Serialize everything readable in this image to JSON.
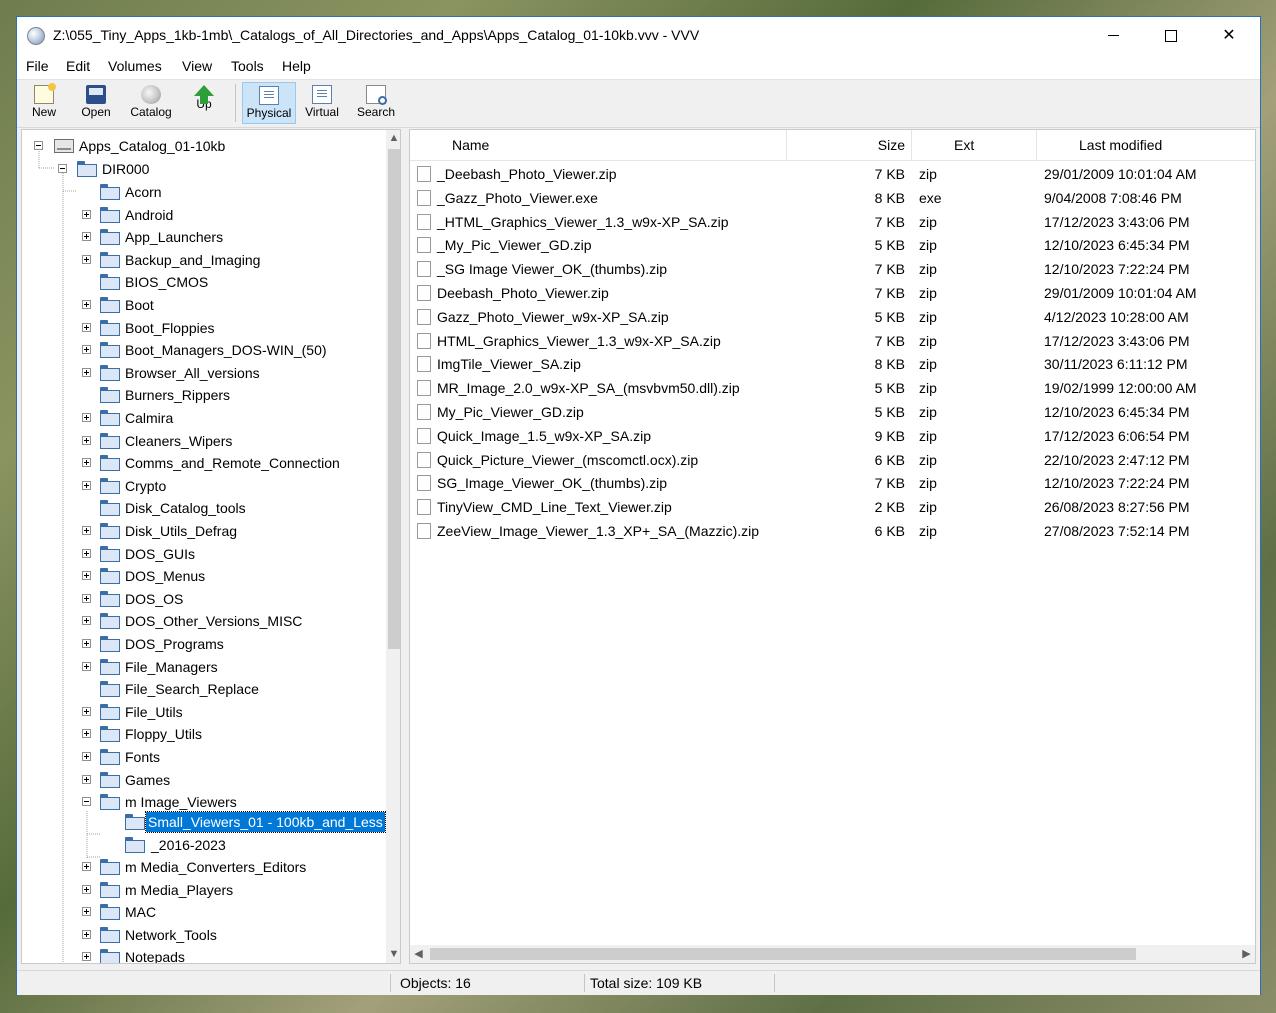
{
  "window": {
    "title": "Z:\\055_Tiny_Apps_1kb-1mb\\_Catalogs_of_All_Directories_and_Apps\\Apps_Catalog_01-10kb.vvv - VVV",
    "minimize": "",
    "maximize": "",
    "close": "✕"
  },
  "menu": [
    "File",
    "Edit",
    "Volumes",
    "View",
    "Tools",
    "Help"
  ],
  "toolbar": {
    "new": "New",
    "open": "Open",
    "catalog": "Catalog",
    "up": "Up",
    "physical": "Physical",
    "virtual": "Virtual",
    "search": "Search"
  },
  "tree": {
    "root": "Apps_Catalog_01-10kb",
    "dir": "DIR000",
    "folders": [
      {
        "label": "Acorn",
        "expandable": false
      },
      {
        "label": "Android",
        "expandable": true
      },
      {
        "label": "App_Launchers",
        "expandable": true
      },
      {
        "label": "Backup_and_Imaging",
        "expandable": true
      },
      {
        "label": "BIOS_CMOS",
        "expandable": false
      },
      {
        "label": "Boot",
        "expandable": true
      },
      {
        "label": "Boot_Floppies",
        "expandable": true
      },
      {
        "label": "Boot_Managers_DOS-WIN_(50)",
        "expandable": true
      },
      {
        "label": "Browser_All_versions",
        "expandable": true
      },
      {
        "label": "Burners_Rippers",
        "expandable": false
      },
      {
        "label": "Calmira",
        "expandable": true
      },
      {
        "label": "Cleaners_Wipers",
        "expandable": true
      },
      {
        "label": "Comms_and_Remote_Connection",
        "expandable": true
      },
      {
        "label": "Crypto",
        "expandable": true
      },
      {
        "label": "Disk_Catalog_tools",
        "expandable": false
      },
      {
        "label": "Disk_Utils_Defrag",
        "expandable": true
      },
      {
        "label": "DOS_GUIs",
        "expandable": true
      },
      {
        "label": "DOS_Menus",
        "expandable": true
      },
      {
        "label": "DOS_OS",
        "expandable": true
      },
      {
        "label": "DOS_Other_Versions_MISC",
        "expandable": true
      },
      {
        "label": "DOS_Programs",
        "expandable": true
      },
      {
        "label": "File_Managers",
        "expandable": true
      },
      {
        "label": "File_Search_Replace",
        "expandable": false
      },
      {
        "label": "File_Utils",
        "expandable": true
      },
      {
        "label": "Floppy_Utils",
        "expandable": true
      },
      {
        "label": "Fonts",
        "expandable": true
      },
      {
        "label": "Games",
        "expandable": true
      },
      {
        "label": "m Image_Viewers",
        "expandable": true,
        "expanded": true
      }
    ],
    "image_viewers_children": [
      "Small_Viewers_01 - 100kb_and_Less",
      "_2016-2023"
    ],
    "folders_after": [
      {
        "label": "m Media_Converters_Editors",
        "expandable": true
      },
      {
        "label": "m Media_Players",
        "expandable": true
      },
      {
        "label": "MAC",
        "expandable": true
      },
      {
        "label": "Network_Tools",
        "expandable": true
      },
      {
        "label": "Notepads",
        "expandable": true
      }
    ]
  },
  "list": {
    "columns": {
      "name": "Name",
      "size": "Size",
      "ext": "Ext",
      "modified": "Last modified"
    },
    "files": [
      {
        "name": "_Deebash_Photo_Viewer.zip",
        "size": "7 KB",
        "ext": "zip",
        "modified": "29/01/2009 10:01:04 AM"
      },
      {
        "name": "_Gazz_Photo_Viewer.exe",
        "size": "8 KB",
        "ext": "exe",
        "modified": "9/04/2008 7:08:46 PM"
      },
      {
        "name": "_HTML_Graphics_Viewer_1.3_w9x-XP_SA.zip",
        "size": "7 KB",
        "ext": "zip",
        "modified": "17/12/2023 3:43:06 PM"
      },
      {
        "name": "_My_Pic_Viewer_GD.zip",
        "size": "5 KB",
        "ext": "zip",
        "modified": "12/10/2023 6:45:34 PM"
      },
      {
        "name": "_SG Image Viewer_OK_(thumbs).zip",
        "size": "7 KB",
        "ext": "zip",
        "modified": "12/10/2023 7:22:24 PM"
      },
      {
        "name": "Deebash_Photo_Viewer.zip",
        "size": "7 KB",
        "ext": "zip",
        "modified": "29/01/2009 10:01:04 AM"
      },
      {
        "name": "Gazz_Photo_Viewer_w9x-XP_SA.zip",
        "size": "5 KB",
        "ext": "zip",
        "modified": "4/12/2023 10:28:00 AM"
      },
      {
        "name": "HTML_Graphics_Viewer_1.3_w9x-XP_SA.zip",
        "size": "7 KB",
        "ext": "zip",
        "modified": "17/12/2023 3:43:06 PM"
      },
      {
        "name": "ImgTile_Viewer_SA.zip",
        "size": "8 KB",
        "ext": "zip",
        "modified": "30/11/2023 6:11:12 PM"
      },
      {
        "name": "MR_Image_2.0_w9x-XP_SA_(msvbvm50.dll).zip",
        "size": "5 KB",
        "ext": "zip",
        "modified": "19/02/1999 12:00:00 AM"
      },
      {
        "name": "My_Pic_Viewer_GD.zip",
        "size": "5 KB",
        "ext": "zip",
        "modified": "12/10/2023 6:45:34 PM"
      },
      {
        "name": "Quick_Image_1.5_w9x-XP_SA.zip",
        "size": "9 KB",
        "ext": "zip",
        "modified": "17/12/2023 6:06:54 PM"
      },
      {
        "name": "Quick_Picture_Viewer_(mscomctl.ocx).zip",
        "size": "6 KB",
        "ext": "zip",
        "modified": "22/10/2023 2:47:12 PM"
      },
      {
        "name": "SG_Image_Viewer_OK_(thumbs).zip",
        "size": "7 KB",
        "ext": "zip",
        "modified": "12/10/2023 7:22:24 PM"
      },
      {
        "name": "TinyView_CMD_Line_Text_Viewer.zip",
        "size": "2 KB",
        "ext": "zip",
        "modified": "26/08/2023 8:27:56 PM"
      },
      {
        "name": "ZeeView_Image_Viewer_1.3_XP+_SA_(Mazzic).zip",
        "size": "6 KB",
        "ext": "zip",
        "modified": "27/08/2023 7:52:14 PM"
      }
    ]
  },
  "status": {
    "objects": "Objects: 16",
    "total": "Total size: 109 KB"
  },
  "colors": {
    "selection": "#0078d7",
    "folder": "#3a6ea5",
    "window_border": "#2b6fb5"
  }
}
